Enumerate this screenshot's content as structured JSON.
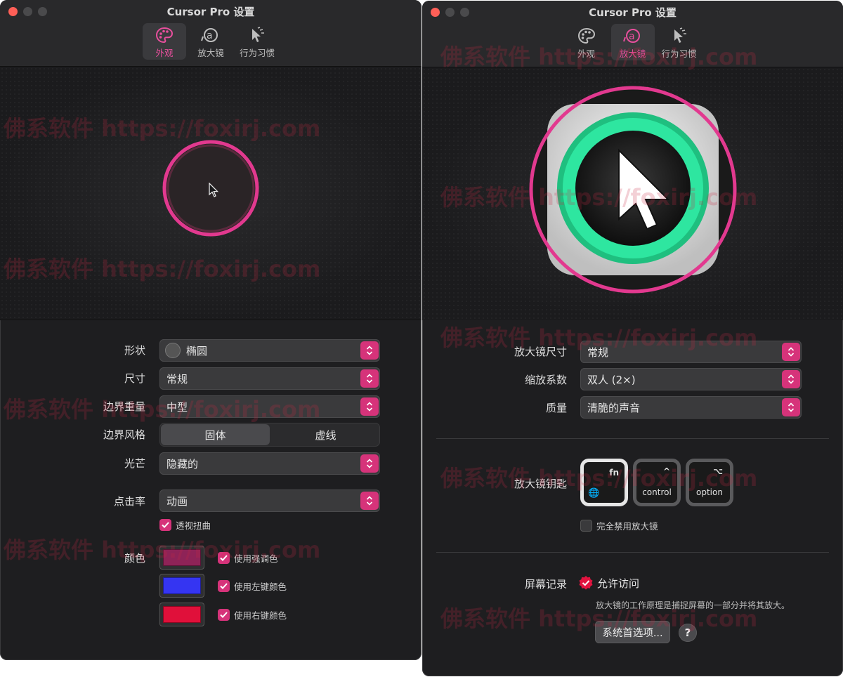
{
  "watermark": "佛系软件 https://foxirj.com",
  "left_window": {
    "title": "Cursor Pro 设置",
    "tabs": [
      {
        "label": "外观",
        "icon": "palette-icon",
        "active": true
      },
      {
        "label": "放大镜",
        "icon": "magnifier-icon",
        "active": false
      },
      {
        "label": "行为习惯",
        "icon": "cursor-click-icon",
        "active": false
      }
    ],
    "settings": {
      "shape": {
        "label": "形状",
        "value": "椭圆"
      },
      "size": {
        "label": "尺寸",
        "value": "常规"
      },
      "border_weight": {
        "label": "边界重量",
        "value": "中型"
      },
      "border_style": {
        "label": "边界风格",
        "options": [
          "固体",
          "虚线"
        ],
        "selected": "固体"
      },
      "glow": {
        "label": "光芒",
        "value": "隐藏的"
      },
      "click_rate": {
        "label": "点击率",
        "value": "动画"
      },
      "perspective": {
        "label": "透视扭曲",
        "checked": true
      },
      "colors": {
        "label": "颜色",
        "items": [
          {
            "swatch": "#8e2357",
            "label": "使用强调色",
            "checked": true
          },
          {
            "swatch": "#3535f2",
            "label": "使用左键颜色",
            "checked": true
          },
          {
            "swatch": "#e0103a",
            "label": "使用右键颜色",
            "checked": true
          }
        ]
      }
    }
  },
  "right_window": {
    "title": "Cursor Pro 设置",
    "tabs": [
      {
        "label": "外观",
        "icon": "palette-icon",
        "active": false
      },
      {
        "label": "放大镜",
        "icon": "magnifier-icon",
        "active": true
      },
      {
        "label": "行为习惯",
        "icon": "cursor-click-icon",
        "active": false
      }
    ],
    "settings": {
      "magnifier_size": {
        "label": "放大镜尺寸",
        "value": "常规"
      },
      "zoom_factor": {
        "label": "缩放系数",
        "value": "双人 (2×)"
      },
      "quality": {
        "label": "质量",
        "value": "清脆的声音"
      },
      "magnifier_key": {
        "label": "放大镜钥匙",
        "keys": [
          {
            "top": "fn",
            "bottom": "🌐",
            "selected": true
          },
          {
            "top": "^",
            "bottom": "control",
            "selected": false
          },
          {
            "top": "⌥",
            "bottom": "option",
            "selected": false
          }
        ]
      },
      "disable_magnifier": {
        "label": "完全禁用放大镜",
        "checked": false
      },
      "screen_recording": {
        "label": "屏幕记录",
        "status": "允许访问",
        "note": "放大镜的工作原理是捕捉屏幕的一部分并将其放大。",
        "button": "系统首选项...",
        "help": "?"
      }
    }
  },
  "colors": {
    "accent": "#e84f9d",
    "accent_dark": "#d6337a",
    "magnifier_ring": "#27d98e"
  }
}
